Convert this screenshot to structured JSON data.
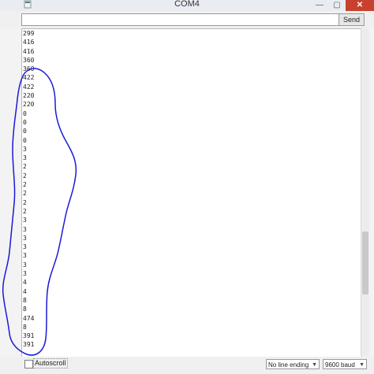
{
  "window": {
    "title": "COM4",
    "min_glyph": "—",
    "max_glyph": "▢",
    "close_glyph": "✕"
  },
  "send": {
    "input_value": "",
    "button_label": "Send"
  },
  "output": {
    "lines": [
      "299",
      "416",
      "416",
      "360",
      "360",
      "422",
      "422",
      "220",
      "220",
      "0",
      "0",
      "0",
      "0",
      "3",
      "3",
      "2",
      "2",
      "2",
      "2",
      "2",
      "2",
      "3",
      "3",
      "3",
      "3",
      "3",
      "3",
      "3",
      "4",
      "4",
      "8",
      "8",
      "474",
      "8",
      "391",
      "391"
    ]
  },
  "status": {
    "autoscroll_label": "Autoscroll",
    "autoscroll_checked": false,
    "line_ending": "No line ending",
    "baud": "9600 baud",
    "dropdown_glyph": "▼"
  },
  "colors": {
    "annotation": "#1a1ad8",
    "close_button": "#c8412e"
  }
}
